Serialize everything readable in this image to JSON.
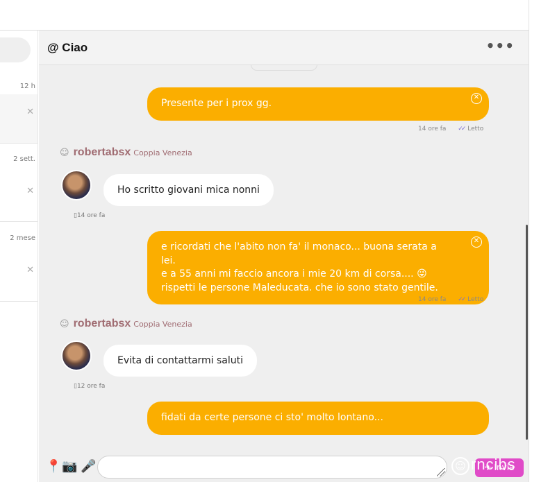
{
  "sidebar": {
    "times": [
      "12 h",
      "2 sett.",
      "2 mese"
    ]
  },
  "header": {
    "title": "@ Ciao",
    "menu_icon": "more-dots-icon"
  },
  "messages": {
    "m1": {
      "text": "Presente per i prox gg.",
      "time": "14 ore fa",
      "read": "Letto"
    },
    "s1": {
      "name": "robertabsx",
      "location": "Coppia Venezia"
    },
    "m2": {
      "text": "Ho scritto giovani mica nonni",
      "time": "14 ore fa"
    },
    "m3": {
      "line1": "e ricordati che l'abito non fa' il monaco... buona serata a lei.",
      "line2": "e a 55 anni mi faccio ancora i mie 20 km di corsa....",
      "emoji": "😜",
      "line3": "rispetti le persone Maleducata. che io sono stato gentile.",
      "time": "14 ore fa",
      "read": "Letto"
    },
    "s2": {
      "name": "robertabsx",
      "location": "Coppia Venezia"
    },
    "m4": {
      "text": "Evita di contattarmi saluti",
      "time": "12 ore fa"
    },
    "m5": {
      "text": "fidati da certe persone ci sto' molto lontano..."
    }
  },
  "footer": {
    "input_placeholder": "",
    "send_label": "Invia",
    "ghost_text": "rncibs"
  },
  "colors": {
    "outgoing": "#fbae00",
    "send": "#e04bc8",
    "sender": "#a06c72"
  }
}
